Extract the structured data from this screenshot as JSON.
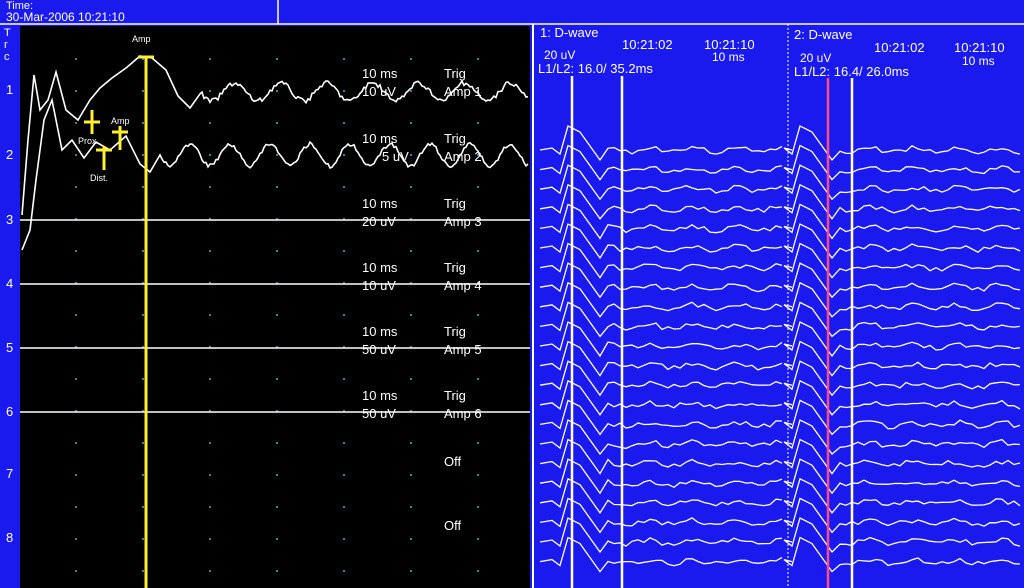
{
  "header": {
    "time_label": "Time:",
    "time_value": "30-Mar-2006 10:21:10"
  },
  "trace_axis_label": "Trc",
  "trace_numbers": [
    "1",
    "2",
    "3",
    "4",
    "5",
    "6",
    "7",
    "8"
  ],
  "cursor_label": "Amp",
  "markers": {
    "prox": "Prox.",
    "dist": "Dist.",
    "amp": "Amp"
  },
  "channels": [
    {
      "timebase": "10 ms",
      "gain": "10 uV",
      "trigger": "Trig",
      "name": "Amp 1",
      "active": true
    },
    {
      "timebase": "10 ms",
      "gain": "5 uV",
      "trigger": "Trig",
      "name": "Amp 2",
      "active": false
    },
    {
      "timebase": "10 ms",
      "gain": "20 uV",
      "trigger": "Trig",
      "name": "Amp 3",
      "active": false
    },
    {
      "timebase": "10 ms",
      "gain": "10 uV",
      "trigger": "Trig",
      "name": "Amp 4",
      "active": false
    },
    {
      "timebase": "10 ms",
      "gain": "50 uV",
      "trigger": "Trig",
      "name": "Amp 5",
      "active": false
    },
    {
      "timebase": "10 ms",
      "gain": "50 uV",
      "trigger": "Trig",
      "name": "Amp 6",
      "active": false
    },
    {
      "status": "Off"
    },
    {
      "status": "Off"
    }
  ],
  "panels": [
    {
      "title": "1: D-wave",
      "gain": "20 uV",
      "time_start": "10:21:02",
      "time_end": "10:21:10",
      "timebase": "10 ms",
      "latency": "L1/L2: 16.0/ 35.2ms"
    },
    {
      "title": "2: D-wave",
      "gain": "20 uV",
      "time_start": "10:21:02",
      "time_end": "10:21:10",
      "timebase": "10 ms",
      "latency": "L1/L2: 16.4/ 26.0ms"
    }
  ],
  "colors": {
    "background": "#1a1aee",
    "plot_area": "#000000",
    "trace": "#ffffff",
    "cursor": "#ffee33",
    "trigger_active": "#ff3b1a",
    "panel_marker": "#ff4a8a"
  }
}
